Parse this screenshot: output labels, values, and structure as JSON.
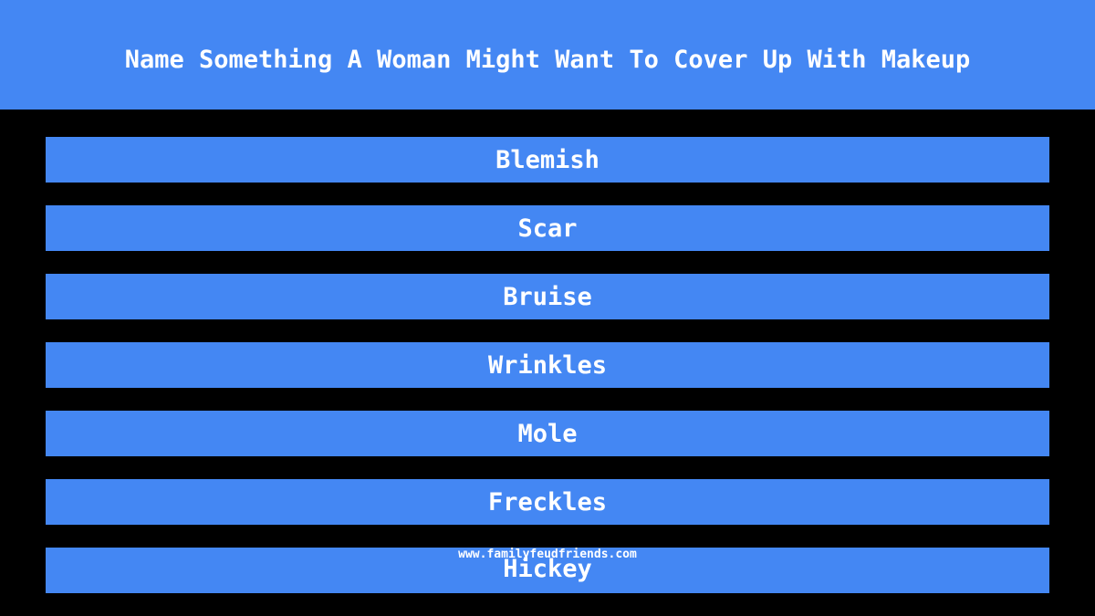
{
  "question": "Name Something A Woman Might Want To Cover Up With Makeup",
  "answers": [
    "Blemish",
    "Scar",
    "Bruise",
    "Wrinkles",
    "Mole",
    "Freckles",
    "Hickey"
  ],
  "watermark": "www.familyfeudfriends.com",
  "colors": {
    "accent": "#4487f3",
    "background": "#000000",
    "text": "#ffffff"
  }
}
